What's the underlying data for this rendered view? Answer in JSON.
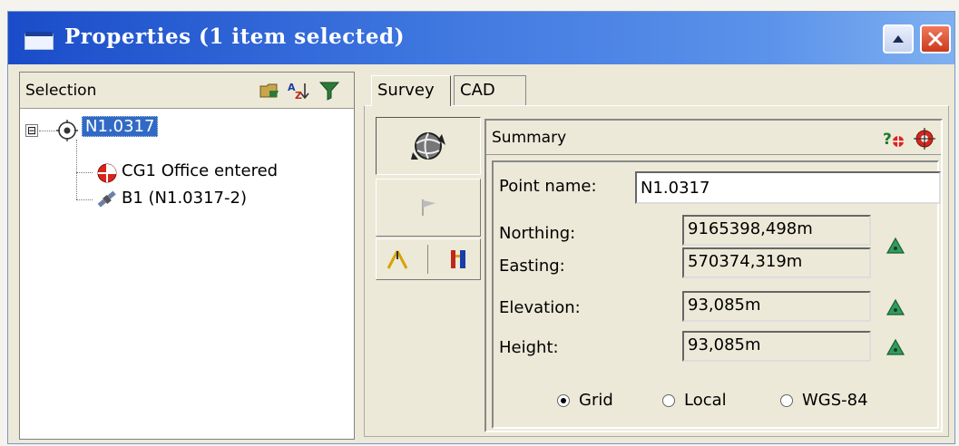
{
  "window": {
    "title": "Properties (1 item selected)"
  },
  "selection": {
    "title": "Selection",
    "tree": {
      "root": {
        "label": "N1.0317",
        "expander": "⊟"
      },
      "children": [
        {
          "label": "CG1 Office entered"
        },
        {
          "label": "B1 (N1.0317-2)"
        }
      ]
    }
  },
  "tabs": [
    {
      "label": "Survey",
      "active": true
    },
    {
      "label": "CAD",
      "active": false
    }
  ],
  "summary": {
    "title": "Summary",
    "point_name_label": "Point name:",
    "point_name_value": "N1.0317",
    "fields": [
      {
        "label": "Northing:",
        "value": "9165398,498m"
      },
      {
        "label": "Easting:",
        "value": "570374,319m"
      },
      {
        "label": "Elevation:",
        "value": "93,085m"
      },
      {
        "label": "Height:",
        "value": "93,085m"
      }
    ],
    "coord_options": [
      {
        "label": "Grid",
        "checked": true
      },
      {
        "label": "Local",
        "checked": false
      },
      {
        "label": "WGS-84",
        "checked": false
      }
    ]
  },
  "colors": {
    "titlebar": "#1a4cc9",
    "selection_highlight": "#316ac5",
    "triangle_icon": "#2f9e5a"
  }
}
